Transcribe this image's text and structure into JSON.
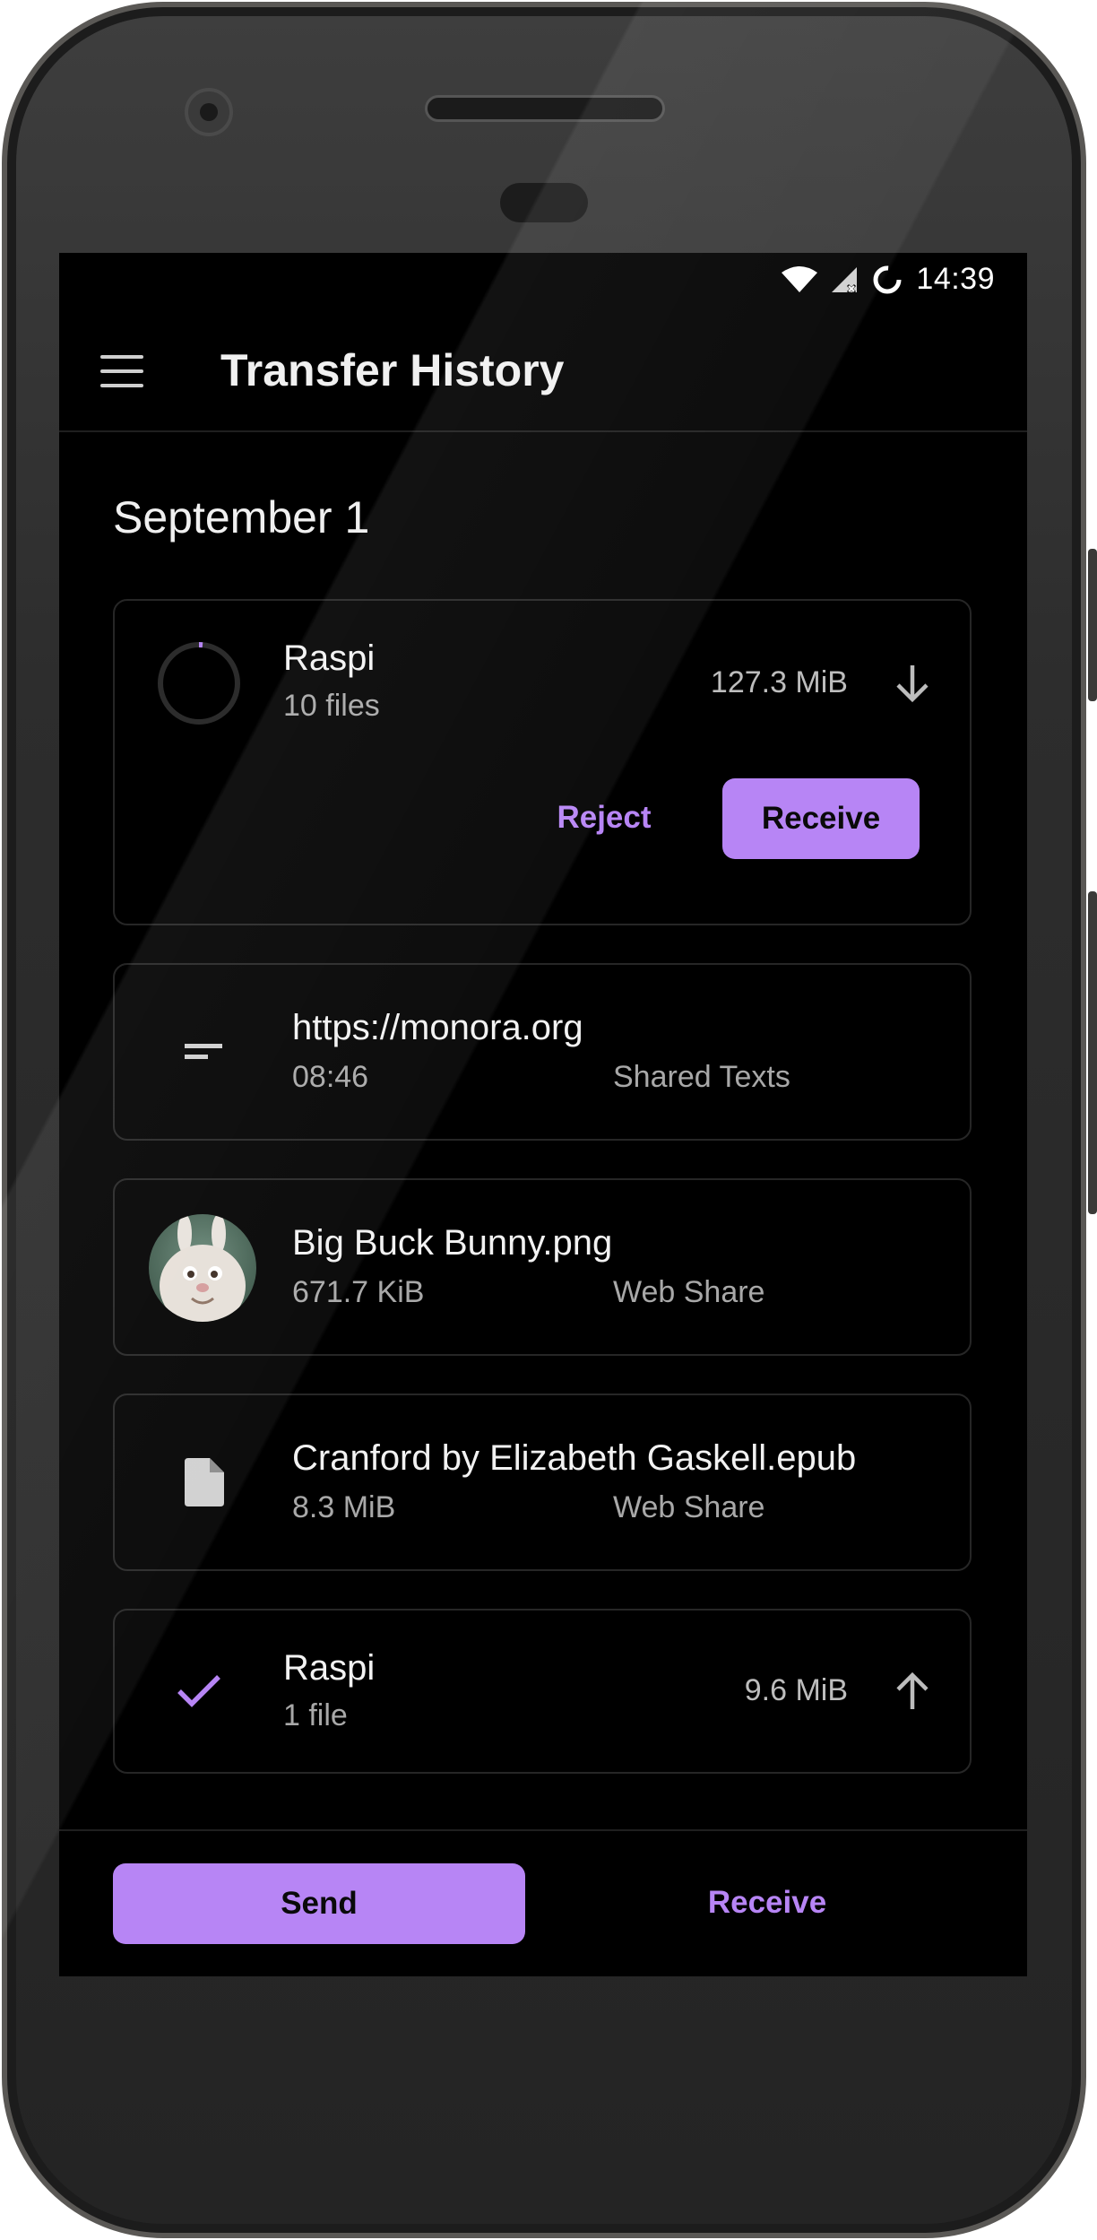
{
  "status_bar": {
    "time": "14:39"
  },
  "app_bar": {
    "title": "Transfer History",
    "menu_icon": "menu-icon"
  },
  "section": {
    "date": "September 1"
  },
  "pending_transfer": {
    "device": "Raspi",
    "count": "10 files",
    "size": "127.3 MiB",
    "direction_icon": "arrow-down-icon",
    "reject_label": "Reject",
    "receive_label": "Receive"
  },
  "items": [
    {
      "title": "https://monora.org",
      "meta": "08:46",
      "source": "Shared Texts",
      "icon": "text-icon"
    },
    {
      "title": "Big Buck Bunny.png",
      "meta": "671.7 KiB",
      "source": "Web Share",
      "icon": "image-thumbnail"
    },
    {
      "title": "Cranford by Elizabeth Gaskell.epub",
      "meta": "8.3 MiB",
      "source": "Web Share",
      "icon": "file-icon"
    }
  ],
  "completed_transfer": {
    "device": "Raspi",
    "count": "1 file",
    "size": "9.6 MiB",
    "direction_icon": "arrow-up-icon",
    "status_icon": "check-icon"
  },
  "bottom_bar": {
    "send_label": "Send",
    "receive_label": "Receive"
  },
  "colors": {
    "accent": "#b785f5",
    "background": "#000000",
    "card_border": "#262626"
  }
}
